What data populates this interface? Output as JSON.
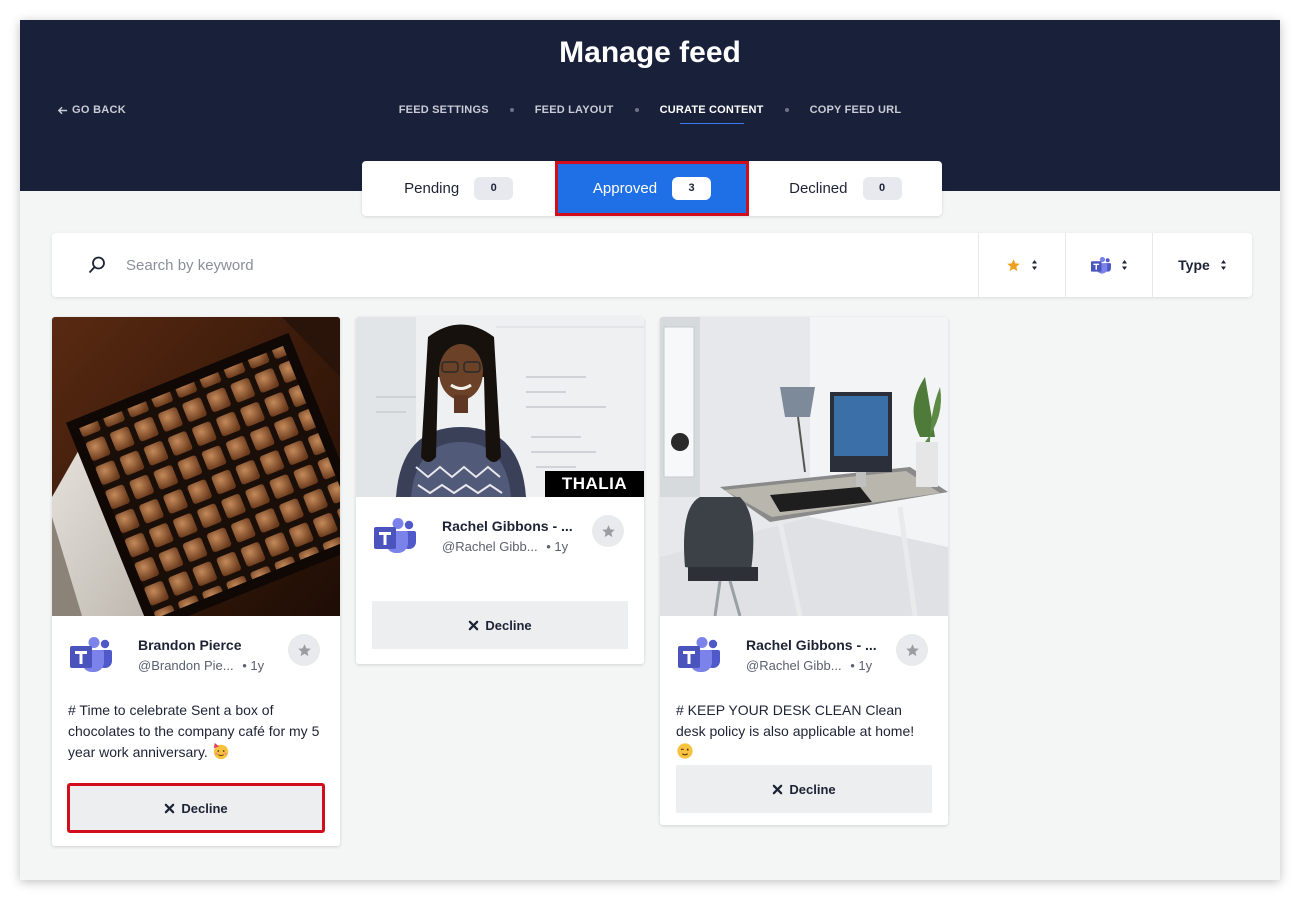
{
  "page": {
    "title": "Manage feed",
    "go_back": "GO BACK"
  },
  "nav": {
    "items": [
      {
        "label": "FEED SETTINGS",
        "active": false
      },
      {
        "label": "FEED LAYOUT",
        "active": false
      },
      {
        "label": "CURATE CONTENT",
        "active": true
      },
      {
        "label": "COPY FEED URL",
        "active": false
      }
    ]
  },
  "tabs": [
    {
      "label": "Pending",
      "count": "0",
      "active": false
    },
    {
      "label": "Approved",
      "count": "3",
      "active": true
    },
    {
      "label": "Declined",
      "count": "0",
      "active": false
    }
  ],
  "toolbar": {
    "search_placeholder": "Search by keyword",
    "filter_type_label": "Type",
    "star_color": "#f0a020",
    "teams_color": "#5059c9"
  },
  "cards": [
    {
      "author": "Brandon Pierce",
      "handle": "@Brandon Pie...",
      "age": "• 1y",
      "text": "# Time to celebrate Sent a box of chocolates to the company café for my 5 year work anniversary.",
      "emoji": "partying-face",
      "decline_label": "Decline",
      "media": "chocolate-box-photo"
    },
    {
      "author": "Rachel Gibbons - ...",
      "handle": "@Rachel Gibb...",
      "age": "• 1y",
      "media_caption": "THALIA",
      "decline_label": "Decline",
      "media": "portrait-photo"
    },
    {
      "author": "Rachel Gibbons - ...",
      "handle": "@Rachel Gibb...",
      "age": "• 1y",
      "text": "# KEEP YOUR DESK CLEAN Clean desk policy is also applicable at home!",
      "emoji": "winking-face",
      "decline_label": "Decline",
      "media": "home-office-desk-photo"
    }
  ],
  "colors": {
    "header_bg": "#19203a",
    "accent_blue": "#1f6fe6",
    "highlight_red": "#d10d1e"
  }
}
